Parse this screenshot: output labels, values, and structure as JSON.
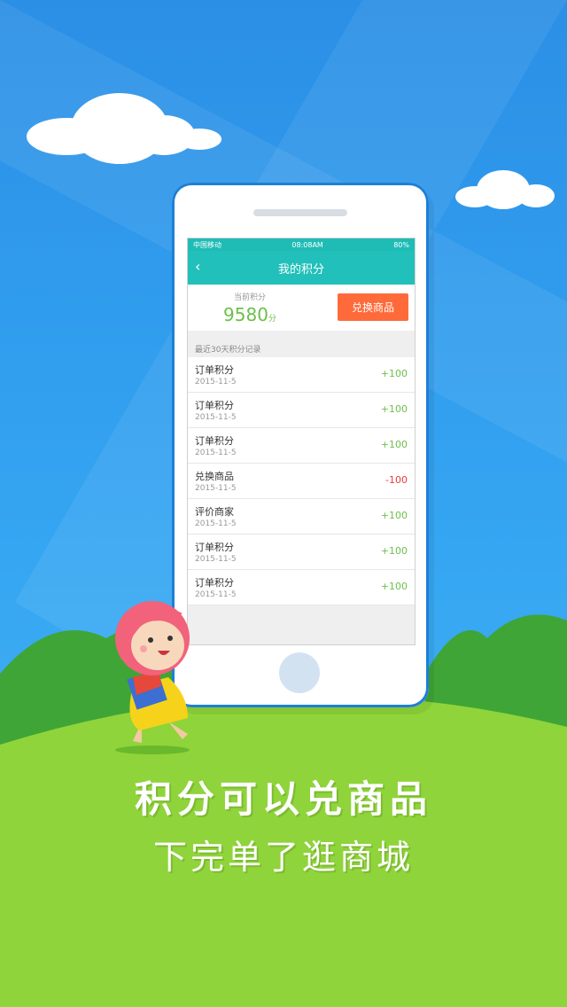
{
  "phone": {
    "status": {
      "carrier": "中国移动",
      "time": "08:08AM",
      "battery": "80%"
    },
    "nav": {
      "title": "我的积分"
    },
    "points": {
      "label": "当前积分",
      "value": "9580",
      "unit": "分",
      "redeem_button": "兑换商品"
    },
    "section_title": "最近30天积分记录",
    "records": [
      {
        "name": "订单积分",
        "date": "2015-11-5",
        "delta": "+100"
      },
      {
        "name": "订单积分",
        "date": "2015-11-5",
        "delta": "+100"
      },
      {
        "name": "订单积分",
        "date": "2015-11-5",
        "delta": "+100"
      },
      {
        "name": "兑换商品",
        "date": "2015-11-5",
        "delta": "-100"
      },
      {
        "name": "评价商家",
        "date": "2015-11-5",
        "delta": "+100"
      },
      {
        "name": "订单积分",
        "date": "2015-11-5",
        "delta": "+100"
      },
      {
        "name": "订单积分",
        "date": "2015-11-5",
        "delta": "+100"
      }
    ]
  },
  "caption": {
    "line1": "积分可以兑商品",
    "line2": "下完单了逛商城"
  },
  "colors": {
    "header": "#22c0ba",
    "positive": "#6cc04a",
    "negative": "#e83b3b",
    "redeem": "#ff6a3a",
    "sky": "#35a6f2",
    "grass": "#8fd43a"
  }
}
